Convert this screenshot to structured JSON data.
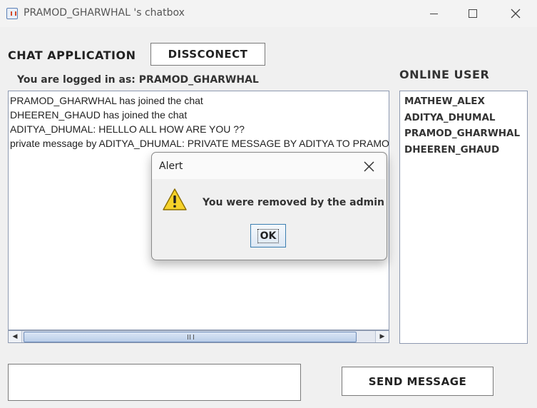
{
  "window": {
    "title": "PRAMOD_GHARWHAL 's chatbox"
  },
  "header": {
    "app_title": "CHAT APPLICATION",
    "disconnect_label": "DISSCONECT",
    "logged_in_text": "You are logged in as: PRAMOD_GHARWHAL"
  },
  "chat": {
    "messages": [
      "PRAMOD_GHARWHAL has joined the chat",
      "DHEEREN_GHAUD has joined the chat",
      "ADITYA_DHUMAL: HELLLO ALL HOW ARE YOU ??",
      "private message by ADITYA_DHUMAL: PRIVATE MESSAGE BY ADITYA TO PRAMOD"
    ]
  },
  "online": {
    "title": "ONLINE USER",
    "users": [
      "MATHEW_ALEX",
      "ADITYA_DHUMAL",
      "PRAMOD_GHARWHAL",
      "DHEEREN_GHAUD"
    ]
  },
  "composer": {
    "input_value": "",
    "send_label": "SEND MESSAGE"
  },
  "alert": {
    "title": "Alert",
    "message": "You were removed by the admin",
    "ok_label": "OK",
    "icon": "warning-icon"
  }
}
